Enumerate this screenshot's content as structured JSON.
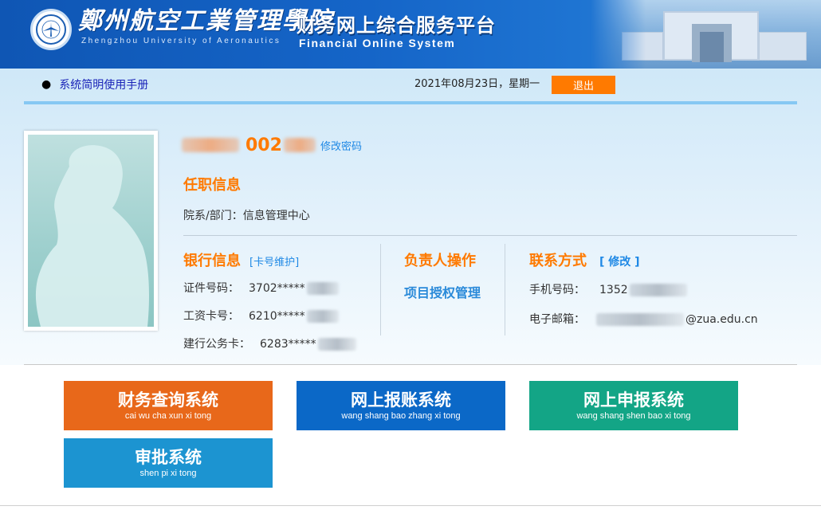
{
  "header": {
    "school_name_cn": "鄭州航空工業管理學院",
    "school_name_en": "Zhengzhou University of Aeronautics",
    "platform_name_cn": "财务网上综合服务平台",
    "platform_name_en": "Financial Online System"
  },
  "toolbar": {
    "manual_link": "系统简明使用手册",
    "date_text": "2021年08月23日，星期一",
    "logout_label": "退出"
  },
  "profile": {
    "name_id_visible": "002",
    "change_password": "修改密码",
    "employment_title": "任职信息",
    "department_label": "院系/部门：",
    "department_value": "信息管理中心"
  },
  "bank": {
    "title": "银行信息",
    "card_maintenance": "[卡号维护]",
    "id_label": "证件号码：",
    "id_value": "3702*****",
    "salary_card_label": "工资卡号：",
    "salary_card_value": "6210*****",
    "ccb_card_label": "建行公务卡：",
    "ccb_card_value": "6283*****"
  },
  "manager": {
    "title": "负责人操作",
    "project_auth": "项目授权管理"
  },
  "contact": {
    "title": "联系方式",
    "edit": "[ 修改 ]",
    "phone_label": "手机号码：",
    "phone_value": "1352",
    "email_label": "电子邮箱：",
    "email_suffix": "@zua.edu.cn"
  },
  "systems": [
    {
      "name": "财务查询系统",
      "pinyin": "cai wu cha xun xi tong",
      "color": "#e8681a"
    },
    {
      "name": "网上报账系统",
      "pinyin": "wang shang bao zhang xi tong",
      "color": "#0b68c7"
    },
    {
      "name": "网上申报系统",
      "pinyin": "wang shang shen bao xi tong",
      "color": "#13a586"
    },
    {
      "name": "审批系统",
      "pinyin": "shen pi xi tong",
      "color": "#1c94d1"
    }
  ],
  "colors": {
    "accent_orange": "#ff7a00",
    "link_blue": "#1e88e5",
    "banner_blue": "#1565c8"
  }
}
